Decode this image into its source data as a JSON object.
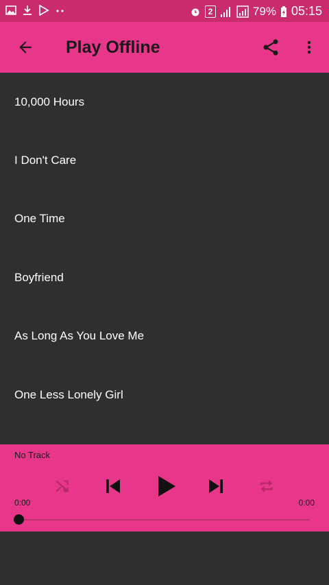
{
  "status_bar": {
    "sim_badge": "2",
    "battery": "79%",
    "time": "05:15",
    "left_icons": [
      "gallery-icon",
      "download-icon",
      "play-store-icon",
      "dots-icon"
    ],
    "right_icons": [
      "alarm-icon",
      "signal-icon",
      "signal-icon",
      "battery-charging-icon"
    ]
  },
  "toolbar": {
    "title": "Play Offline",
    "icons": [
      "back-arrow-icon",
      "share-icon",
      "more-vert-icon"
    ]
  },
  "tracks": [
    "10,000 Hours",
    "I Don't Care",
    "One Time",
    "Boyfriend",
    "As Long As You Love Me",
    "One Less Lonely Girl"
  ],
  "player": {
    "now_playing": "No Track",
    "elapsed": "0:00",
    "duration": "0:00",
    "progress": 0,
    "icons": [
      "shuffle-icon",
      "skip-previous-icon",
      "play-icon",
      "skip-next-icon",
      "repeat-icon"
    ]
  },
  "colors": {
    "status_bar": "#c92b6d",
    "accent": "#e8378a",
    "background": "#2f2f2f",
    "text_on_accent": "#1a1a1a",
    "disabled_icon": "#b82a68"
  }
}
